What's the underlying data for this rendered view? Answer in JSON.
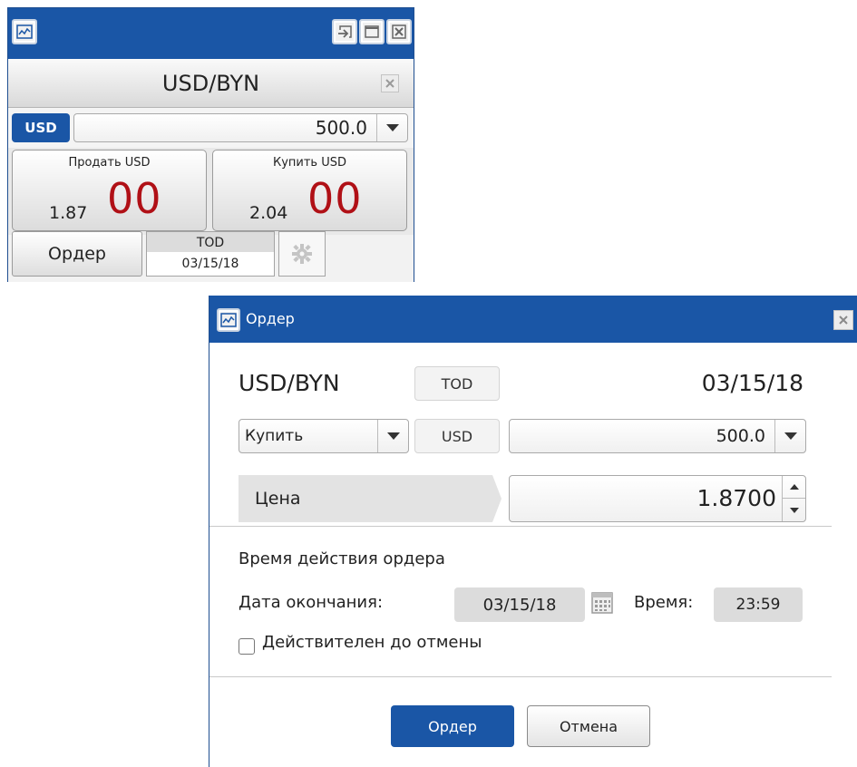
{
  "ticket": {
    "pair": "USD/BYN",
    "currency": "USD",
    "amount": "500.0",
    "sell": {
      "label": "Продать USD",
      "price_small": "1.87",
      "price_big": "00"
    },
    "buy": {
      "label": "Купить USD",
      "price_small": "2.04",
      "price_big": "00"
    },
    "order_label": "Ордер",
    "tenor": "TOD",
    "value_date": "03/15/18"
  },
  "dialog": {
    "title": "Ордер",
    "pair": "USD/BYN",
    "tenor": "TOD",
    "value_date": "03/15/18",
    "side": "Купить",
    "currency": "USD",
    "amount": "500.0",
    "price_label": "Цена",
    "price": "1.8700",
    "validity_section": "Время действия ордера",
    "expiry_label": "Дата окончания:",
    "expiry_date": "03/15/18",
    "time_label": "Время:",
    "time": "23:59",
    "gtc_label": "Действителен до отмены",
    "gtc_checked": false,
    "submit_label": "Ордер",
    "cancel_label": "Отмена"
  },
  "colors": {
    "titlebar": "#1a56a6",
    "accent": "#1a56a6",
    "price_big": "#b01016"
  },
  "icons": [
    "chart-icon",
    "detach-icon",
    "maximize-icon",
    "close-icon",
    "gear-icon",
    "calendar-icon",
    "chevron-down-icon",
    "spin-up-icon",
    "spin-down-icon"
  ]
}
